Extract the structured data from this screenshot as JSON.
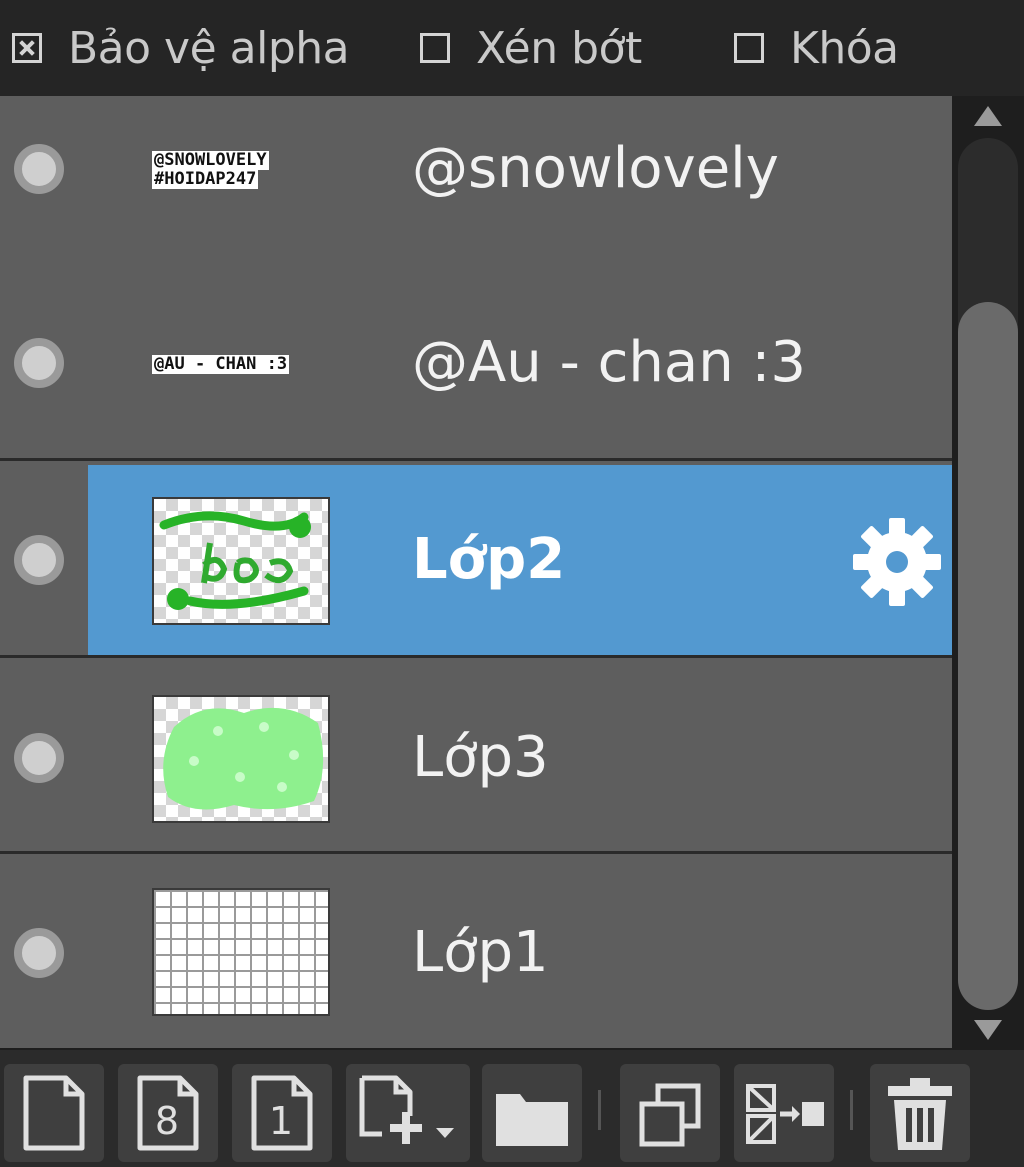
{
  "options": {
    "alpha_protect": {
      "label": "Bảo vệ alpha",
      "checked": true
    },
    "clipping": {
      "label": "Xén bớt",
      "checked": false
    },
    "lock": {
      "label": "Khóa",
      "checked": false
    }
  },
  "layers": [
    {
      "name": "@snowlovely",
      "thumb_text": [
        "@SNOWLOVELY",
        "#HOIDAP247"
      ],
      "selected": false
    },
    {
      "name": "@Au - chan :3",
      "thumb_text": [
        "@AU - CHAN :3"
      ],
      "selected": false
    },
    {
      "name": "Lớp2",
      "selected": true
    },
    {
      "name": "Lớp3",
      "selected": false
    },
    {
      "name": "Lớp1",
      "selected": false
    }
  ],
  "toolbar": {
    "buttons": [
      {
        "icon": "new-layer-icon"
      },
      {
        "icon": "new-8bit-layer-icon",
        "glyph": "8"
      },
      {
        "icon": "new-1bit-layer-icon",
        "glyph": "1"
      },
      {
        "icon": "add-layer-menu-icon"
      },
      {
        "icon": "new-folder-icon"
      },
      {
        "icon": "duplicate-layer-icon"
      },
      {
        "icon": "merge-down-icon"
      },
      {
        "icon": "trash-icon"
      }
    ]
  },
  "colors": {
    "selected_row": "#5399d0",
    "row_bg": "#5e5e5e",
    "panel_bg": "#1e1e1e"
  }
}
